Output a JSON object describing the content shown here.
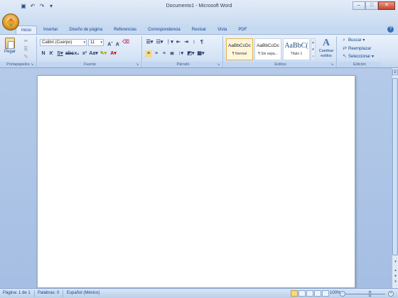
{
  "window": {
    "title": "Documento1 - Microsoft Word",
    "controls": [
      "minimize-icon",
      "maximize-icon",
      "close-icon"
    ]
  },
  "quick_access": [
    "save-icon",
    "undo-icon",
    "redo-icon",
    "customize-icon"
  ],
  "tabs": [
    {
      "label": "Inicio",
      "active": true
    },
    {
      "label": "Insertar"
    },
    {
      "label": "Diseño de página"
    },
    {
      "label": "Referencias"
    },
    {
      "label": "Correspondencia"
    },
    {
      "label": "Revisar"
    },
    {
      "label": "Vista"
    },
    {
      "label": "PDF"
    }
  ],
  "ribbon": {
    "clipboard": {
      "label": "Portapapeles",
      "paste": "Pegar"
    },
    "font": {
      "label": "Fuente",
      "font_name": "Calibri (Cuerpo)",
      "font_size": "11"
    },
    "paragraph": {
      "label": "Párrafo"
    },
    "styles": {
      "label": "Estilos",
      "items": [
        {
          "sample": "AaBbCcDc",
          "name": "¶ Normal"
        },
        {
          "sample": "AaBbCcDc",
          "name": "¶ Sin espa..."
        },
        {
          "sample": "AaBbC(",
          "name": "Título 1"
        }
      ],
      "change_styles": "Cambiar estilos"
    },
    "editing": {
      "label": "Edición",
      "find": "Buscar",
      "replace": "Reemplazar",
      "select": "Seleccionar"
    }
  },
  "status": {
    "page": "Página: 1 de 1",
    "words": "Palabras: 0",
    "language": "Español (México)",
    "zoom": "100%"
  },
  "colors": {
    "ribbon_bg": "#d5e3f5",
    "doc_bg": "#abc3e6",
    "accent_text": "#15428b"
  }
}
